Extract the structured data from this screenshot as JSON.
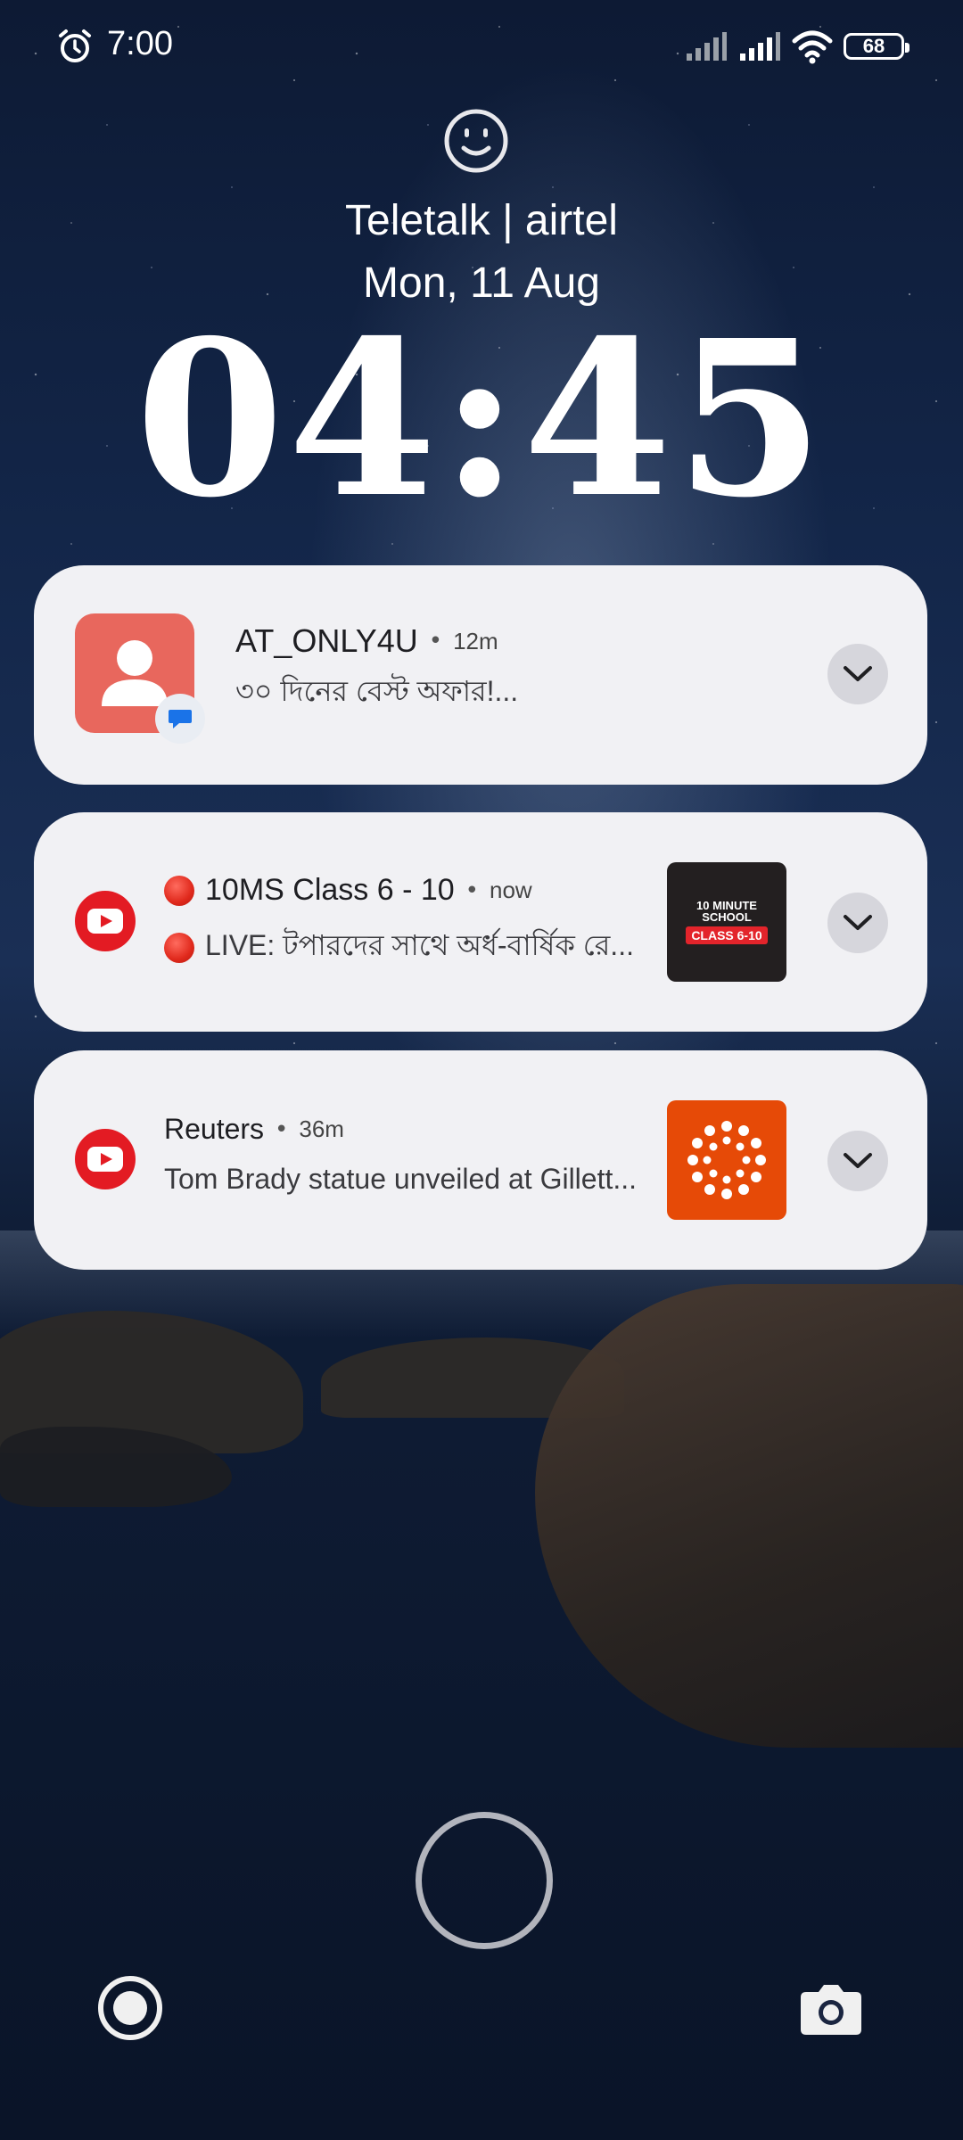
{
  "status_bar": {
    "time": "7:00",
    "battery": "68",
    "icons": [
      "alarm-icon",
      "signal-icon",
      "signal-icon",
      "wifi-icon",
      "battery-icon"
    ]
  },
  "lockscreen": {
    "carrier": "Teletalk | airtel",
    "date": "Mon, 11 Aug",
    "clock": "04:45"
  },
  "notifications": [
    {
      "app_icon": "contact-icon",
      "title": "AT_ONLY4U",
      "time": "12m",
      "body": "৩০ দিনের বেস্ট অফার!..."
    },
    {
      "app_icon": "youtube-icon",
      "title": "10MS Class 6 - 10",
      "time": "now",
      "body": "LIVE: টপারদের সাথে অর্ধ-বার্ষিক রে...",
      "thumbnail": {
        "brand": "10 MINUTE SCHOOL",
        "label": "CLASS 6-10"
      }
    },
    {
      "app_icon": "youtube-icon",
      "title": "Reuters",
      "time": "36m",
      "body": "Tom Brady statue unveiled at Gillett..."
    }
  ],
  "colors": {
    "card_bg": "#f1f1f4",
    "contact_icon": "#e8675d",
    "youtube_red": "#e31b23",
    "reuters_orange": "#e64a07"
  }
}
